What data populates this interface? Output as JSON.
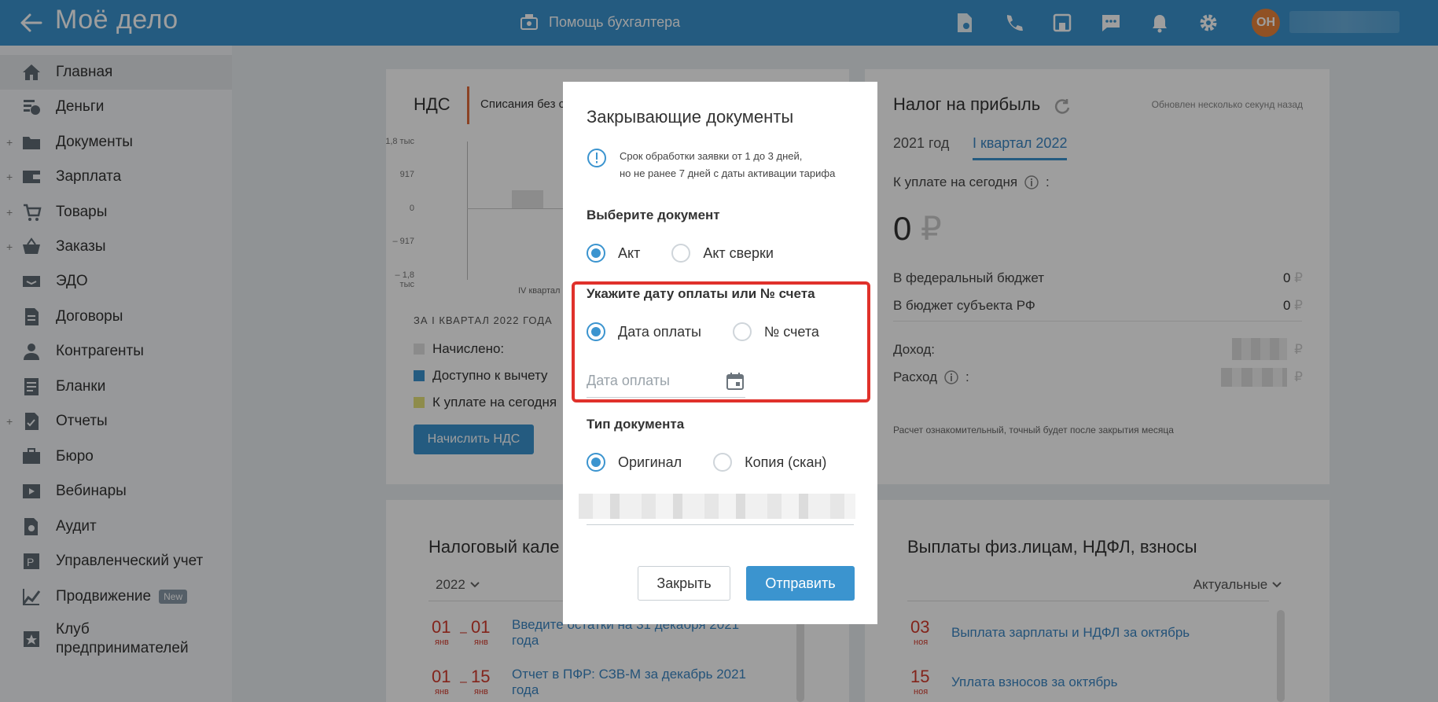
{
  "header": {
    "logo": "Моё дело",
    "help_label": "Помощь бухгалтера",
    "avatar_initials": "ОН"
  },
  "sidebar": {
    "items": [
      {
        "label": "Главная",
        "icon": "home-icon",
        "plus": false,
        "active": true
      },
      {
        "label": "Деньги",
        "icon": "money-icon",
        "plus": false
      },
      {
        "label": "Документы",
        "icon": "folder-icon",
        "plus": true
      },
      {
        "label": "Зарплата",
        "icon": "wallet-icon",
        "plus": true
      },
      {
        "label": "Товары",
        "icon": "cart-icon",
        "plus": true
      },
      {
        "label": "Заказы",
        "icon": "basket-icon",
        "plus": true
      },
      {
        "label": "ЭДО",
        "icon": "edo-icon",
        "plus": false
      },
      {
        "label": "Договоры",
        "icon": "contract-icon",
        "plus": false
      },
      {
        "label": "Контрагенты",
        "icon": "contractors-icon",
        "plus": false
      },
      {
        "label": "Бланки",
        "icon": "forms-icon",
        "plus": false
      },
      {
        "label": "Отчеты",
        "icon": "reports-icon",
        "plus": true
      },
      {
        "label": "Бюро",
        "icon": "briefcase-icon",
        "plus": false
      },
      {
        "label": "Вебинары",
        "icon": "webinar-icon",
        "plus": false
      },
      {
        "label": "Аудит",
        "icon": "audit-icon",
        "plus": false
      },
      {
        "label": "Управленческий учет",
        "icon": "management-icon",
        "plus": false
      },
      {
        "label": "Продвижение",
        "icon": "promo-icon",
        "plus": false,
        "badge": "New"
      },
      {
        "label": "Клуб",
        "label2": "предпринимателей",
        "icon": "club-icon",
        "plus": false
      }
    ]
  },
  "vat_card": {
    "title": "НДС",
    "tab": "Списания без с",
    "ticks": [
      "1,8 тыс",
      "917",
      "0",
      "– 917",
      "– 1,8 тыс"
    ],
    "x_label": "IV квартал",
    "period": "ЗА I КВАРТАЛ 2022 ГОДА",
    "legend": [
      {
        "label": "Начислено:",
        "color": "#e0e0e0"
      },
      {
        "label": "Доступно к вычету",
        "color": "#3b94cf"
      },
      {
        "label": "К уплате на сегодня",
        "color": "#e6e27a"
      }
    ],
    "button": "Начислить НДС"
  },
  "profit_card": {
    "title": "Налог на прибыль",
    "updated": "Обновлен несколько секунд назад",
    "tab_year": "2021 год",
    "tab_quarter": "I квартал 2022",
    "due_label": "К уплате на сегодня",
    "due_colon": ":",
    "due_amount": "0",
    "currency": "₽",
    "federal_label": "В федеральный бюджет",
    "federal_value": "0",
    "regional_label": "В бюджет субъекта РФ",
    "regional_value": "0",
    "income_label": "Доход:",
    "expense_label": "Расход",
    "expense_colon": ":",
    "note": "Расчет ознакомительный, точный будет после закрытия месяца"
  },
  "calendar_card": {
    "title": "Налоговый кале",
    "year": "2022",
    "rows": [
      {
        "d1": "01",
        "m1": "янв",
        "d2": "01",
        "m2": "янв",
        "text": "Введите остатки на 31 декабря 2021",
        "text2": "года"
      },
      {
        "d1": "01",
        "m1": "янв",
        "d2": "15",
        "m2": "янв",
        "text": "Отчет в ПФР: СЗВ-М за декабрь 2021",
        "text2": "года"
      }
    ],
    "dash": "–"
  },
  "payments_card": {
    "title": "Выплаты физ.лицам, НДФЛ, взносы",
    "filter": "Актуальные",
    "rows": [
      {
        "d": "03",
        "m": "ноя",
        "text": "Выплата зарплаты и НДФЛ за октябрь"
      },
      {
        "d": "15",
        "m": "ноя",
        "text": "Уплата взносов за октябрь"
      }
    ]
  },
  "modal": {
    "title": "Закрывающие документы",
    "info_line1": "Срок обработки заявки от 1 до 3 дней,",
    "info_line2": "но не ранее 7 дней с даты активации тарифа",
    "doc_section": "Выберите документ",
    "doc_opt1": "Акт",
    "doc_opt2": "Акт сверки",
    "date_section": "Укажите дату оплаты или № счета",
    "date_opt1": "Дата оплаты",
    "date_opt2": "№ счета",
    "date_placeholder": "Дата оплаты",
    "type_section": "Тип документа",
    "type_opt1": "Оригинал",
    "type_opt2": "Копия (скан)",
    "close_button": "Закрыть",
    "send_button": "Отправить"
  },
  "colors": {
    "brand": "#3b94cf",
    "highlight": "#e0312b",
    "date_red": "#d33a2c"
  }
}
